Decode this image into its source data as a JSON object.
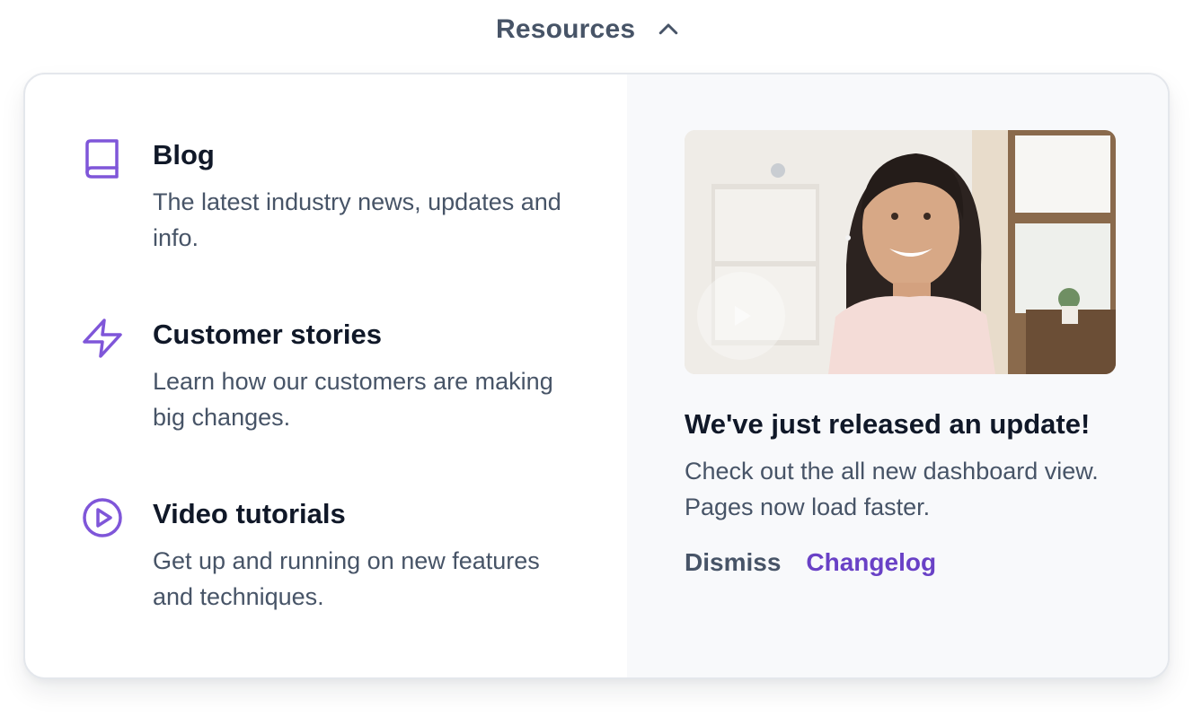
{
  "trigger": {
    "label": "Resources",
    "icon": "chevron-up-icon"
  },
  "items": [
    {
      "title": "Blog",
      "description": "The latest industry news, updates and info.",
      "icon": "book-icon"
    },
    {
      "title": "Customer stories",
      "description": "Learn how our customers are making big changes.",
      "icon": "lightning-icon"
    },
    {
      "title": "Video tutorials",
      "description": "Get up and running on new features and techniques.",
      "icon": "play-circle-icon"
    }
  ],
  "update": {
    "title": "We've just released an update!",
    "description": "Check out the all new dashboard view. Pages now load faster.",
    "dismiss_label": "Dismiss",
    "changelog_label": "Changelog"
  },
  "colors": {
    "accent": "#6941c6",
    "icon": "#7f56d9",
    "heading": "#101828",
    "text": "#475467",
    "panel_right_bg": "#f8f9fb"
  }
}
